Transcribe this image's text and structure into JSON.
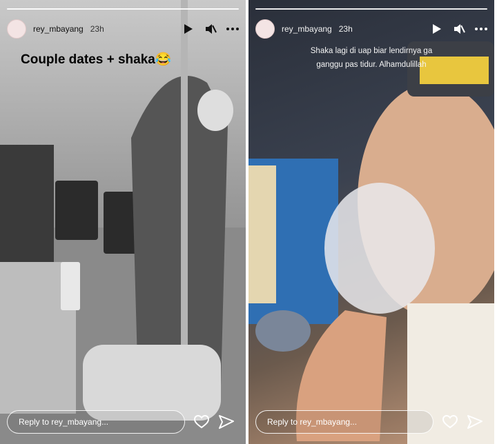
{
  "stories": [
    {
      "username": "rey_mbayang",
      "time": "23h",
      "caption": "Couple dates + shaka😂",
      "reply_placeholder": "Reply to rey_mbayang...",
      "icons": [
        "play-icon",
        "mute-icon",
        "more-icon",
        "heart-icon",
        "send-icon"
      ]
    },
    {
      "username": "rey_mbayang",
      "time": "23h",
      "caption": "Shaka lagi di uap biar lendirnya ga\nganggu pas tidur. Alhamdulillah",
      "reply_placeholder": "Reply to rey_mbayang...",
      "icons": [
        "play-icon",
        "mute-icon",
        "more-icon",
        "heart-icon",
        "send-icon"
      ]
    }
  ]
}
